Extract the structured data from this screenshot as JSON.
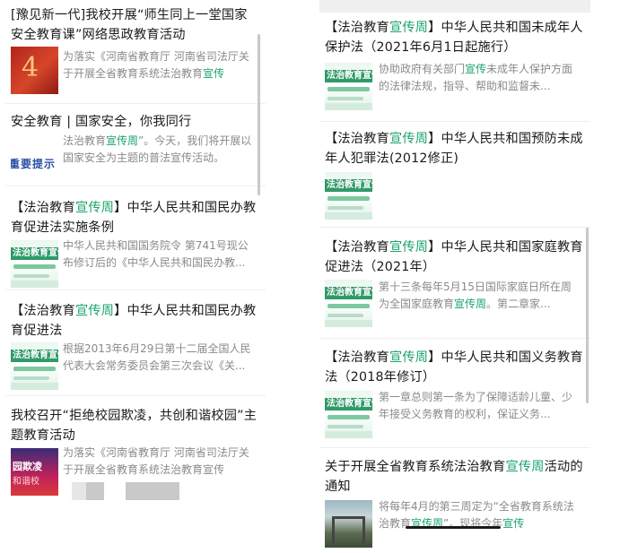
{
  "left": {
    "articles": [
      {
        "title_parts": [
          {
            "t": "[豫见新一代]我校开展“师生同上一堂国家安全教育课”网络思政教育活动",
            "hl": false
          }
        ],
        "snippet_parts": [
          {
            "t": "为落实《河南省教育厅 河南省司法厅关于开展全省教育系统法治教育",
            "hl": false
          },
          {
            "t": "宣传",
            "hl": true
          }
        ],
        "thumb": "red",
        "thumb_text": "4"
      },
      {
        "title_parts": [
          {
            "t": "安全教育 | 国家安全，你我同行",
            "hl": false
          }
        ],
        "snippet_parts": [
          {
            "t": "法治教育",
            "hl": false
          },
          {
            "t": "宣传周",
            "hl": true
          },
          {
            "t": "”。今天，我们将开展以国家安全为主题的普法宣传活动。",
            "hl": false
          }
        ],
        "thumb": "warn",
        "thumb_text": "重要提示"
      },
      {
        "title_parts": [
          {
            "t": "【法治教育",
            "hl": false
          },
          {
            "t": "宣传周",
            "hl": true
          },
          {
            "t": "】中华人民共和国民办教育促进法实施条例",
            "hl": false
          }
        ],
        "snippet_parts": [
          {
            "t": "中华人民共和国国务院令 第741号现公布修订后的《中华人民共和国民办教...",
            "hl": false
          }
        ],
        "thumb": "green",
        "thumb_text": "法治教育宣传周"
      },
      {
        "title_parts": [
          {
            "t": "【法治教育",
            "hl": false
          },
          {
            "t": "宣传周",
            "hl": true
          },
          {
            "t": "】中华人民共和国民办教育促进法",
            "hl": false
          }
        ],
        "snippet_parts": [
          {
            "t": "根据2013年6月29日第十二届全国人民代表大会常务委员会第三次会议《关...",
            "hl": false
          }
        ],
        "thumb": "green",
        "thumb_text": "法治教育宣传周"
      },
      {
        "title_parts": [
          {
            "t": "我校召开“拒绝校园欺凌，共创和谐校园”主题教育活动",
            "hl": false
          }
        ],
        "snippet_parts": [
          {
            "t": "为落实《河南省教育厅 河南省司法厅关于开展全省教育系统法治教育宣传",
            "hl": false
          }
        ],
        "thumb": "bully",
        "thumb_text": "园欺凌",
        "thumb_text2": "和谐校"
      }
    ]
  },
  "right": {
    "articles": [
      {
        "title_parts": [
          {
            "t": "【法治教育",
            "hl": false
          },
          {
            "t": "宣传周",
            "hl": true
          },
          {
            "t": "】中华人民共和国未成年人保护法（2021年6月1日起施行）",
            "hl": false
          }
        ],
        "snippet_parts": [
          {
            "t": "协助政府有关部门",
            "hl": false
          },
          {
            "t": "宣传",
            "hl": true
          },
          {
            "t": "未成年人保护方面的法律法规，指导、帮助和监督未...",
            "hl": false
          }
        ],
        "thumb": "green",
        "thumb_text": "法治教育宣传周"
      },
      {
        "title_parts": [
          {
            "t": "【法治教育",
            "hl": false
          },
          {
            "t": "宣传周",
            "hl": true
          },
          {
            "t": "】中华人民共和国预防未成年人犯罪法(2012修正)",
            "hl": false
          }
        ],
        "snippet_parts": [],
        "thumb": "green",
        "thumb_text": "法治教育宣传周"
      },
      {
        "title_parts": [
          {
            "t": "【法治教育",
            "hl": false
          },
          {
            "t": "宣传周",
            "hl": true
          },
          {
            "t": "】中华人民共和国家庭教育促进法（2021年）",
            "hl": false
          }
        ],
        "snippet_parts": [
          {
            "t": "第十三条每年5月15日国际家庭日所在周为全国家庭教育",
            "hl": false
          },
          {
            "t": "宣传周",
            "hl": true
          },
          {
            "t": "。第二章家...",
            "hl": false
          }
        ],
        "thumb": "green",
        "thumb_text": "法治教育宣传周"
      },
      {
        "title_parts": [
          {
            "t": "【法治教育",
            "hl": false
          },
          {
            "t": "宣传周",
            "hl": true
          },
          {
            "t": "】中华人民共和国义务教育法（2018年修订）",
            "hl": false
          }
        ],
        "snippet_parts": [
          {
            "t": "第一章总则第一条为了保障适龄儿童、少年接受义务教育的权利，保证义务...",
            "hl": false
          }
        ],
        "thumb": "green",
        "thumb_text": "法治教育宣传周"
      },
      {
        "title_parts": [
          {
            "t": "关于开展全省教育系统法治教育",
            "hl": false
          },
          {
            "t": "宣传周",
            "hl": true
          },
          {
            "t": "活动的通知",
            "hl": false
          }
        ],
        "snippet_parts": [
          {
            "t": "将每年4月的第三周定为“全省教育系统法治教育",
            "hl": false
          },
          {
            "t": "宣传周",
            "hl": true
          },
          {
            "t": "”。现将今年",
            "hl": false
          },
          {
            "t": "宣传",
            "hl": true
          }
        ],
        "thumb": "photo",
        "thumb_text": ""
      }
    ]
  }
}
